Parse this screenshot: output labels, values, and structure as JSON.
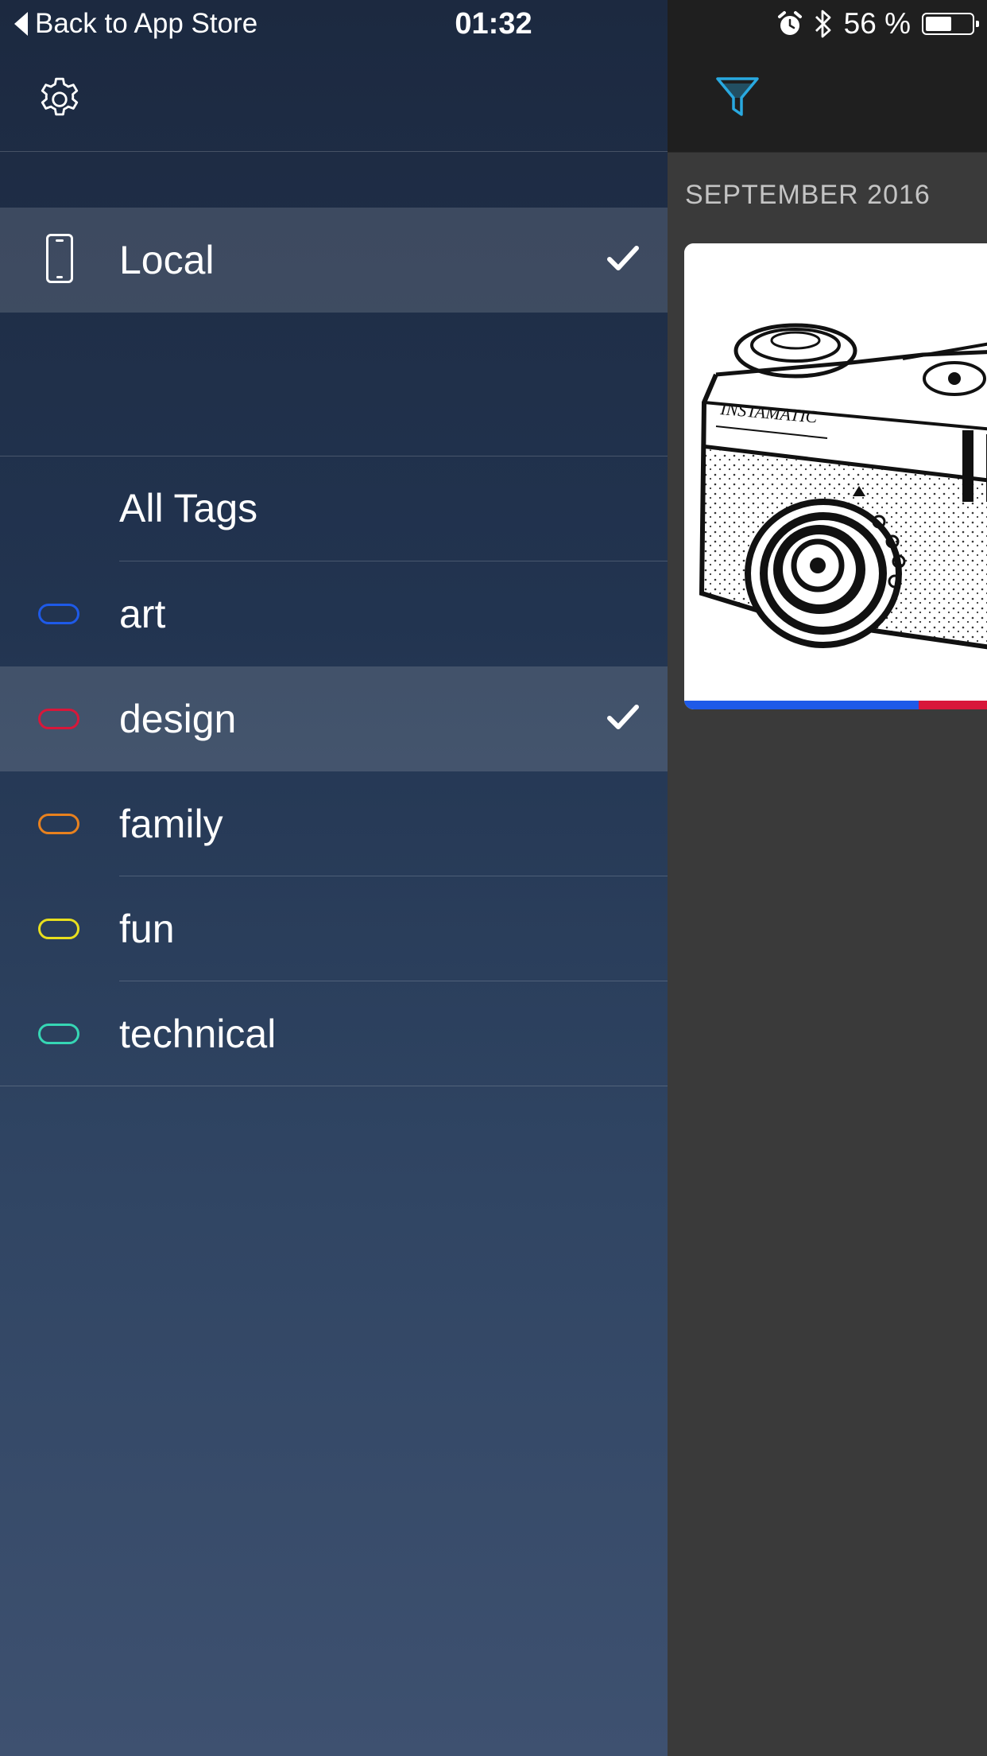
{
  "status_bar": {
    "back_label": "Back to App Store",
    "time": "01:32",
    "battery_text": "56 %",
    "battery_level": 0.56
  },
  "drawer": {
    "sources": [
      {
        "label": "Local",
        "icon": "phone-icon",
        "selected": true
      }
    ],
    "all_tags_label": "All Tags",
    "tags": [
      {
        "label": "art",
        "color": "#1e5ae8",
        "selected": false
      },
      {
        "label": "design",
        "color": "#d8173a",
        "selected": true
      },
      {
        "label": "family",
        "color": "#e8811e",
        "selected": false
      },
      {
        "label": "fun",
        "color": "#e8df1e",
        "selected": false
      },
      {
        "label": "technical",
        "color": "#36d6b4",
        "selected": false
      }
    ]
  },
  "content": {
    "filter_icon_color": "#29a9e0",
    "section_header": "SEPTEMBER 2016",
    "card": {
      "image": "camera-sketch",
      "image_text": "INSTAMATIC",
      "tag_colors": [
        "#1e5ae8",
        "#d8173a"
      ]
    }
  }
}
